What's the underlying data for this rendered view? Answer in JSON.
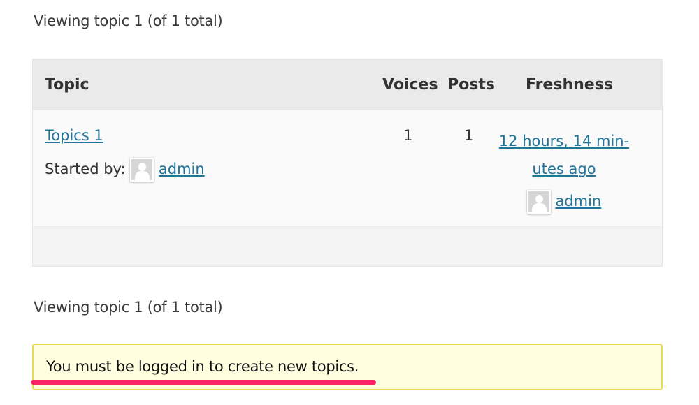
{
  "pagination": {
    "top": "Viewing topic 1 (of 1 total)",
    "bottom": "Viewing topic 1 (of 1 total)"
  },
  "table": {
    "headers": {
      "topic": "Topic",
      "voices": "Voices",
      "posts": "Posts",
      "freshness": "Freshness"
    },
    "rows": [
      {
        "title": "Topics 1",
        "started_by_label": "Started by:",
        "author": "admin",
        "voices": "1",
        "posts": "1",
        "freshness_line1": "12 hours, 14 min-",
        "freshness_line2": "utes ago",
        "last_author": "admin"
      }
    ]
  },
  "notice": {
    "text": "You must be logged in to create new topics.",
    "highlight_color": "#ff2366"
  }
}
